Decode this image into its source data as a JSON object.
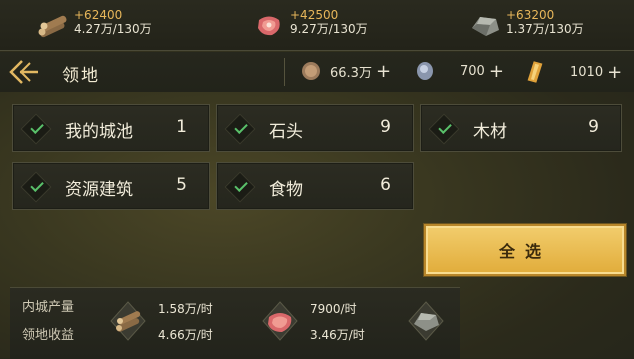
{
  "resources": [
    {
      "icon": "wood-icon",
      "gain": "+62400",
      "amount": "4.27万/130万"
    },
    {
      "icon": "meat-icon",
      "gain": "+42500",
      "amount": "9.27万/130万"
    },
    {
      "icon": "stone-icon",
      "gain": "+63200",
      "amount": "1.37万/130万"
    }
  ],
  "header": {
    "title": "领地"
  },
  "currencies": [
    {
      "icon": "coin-icon",
      "value": "66.3万",
      "plus": "+"
    },
    {
      "icon": "silver-icon",
      "value": "700",
      "plus": "+"
    },
    {
      "icon": "gold-icon",
      "value": "1010",
      "plus": "+"
    }
  ],
  "filters": [
    {
      "label": "我的城池",
      "count": "1"
    },
    {
      "label": "石头",
      "count": "9"
    },
    {
      "label": "木材",
      "count": "9"
    },
    {
      "label": "资源建筑",
      "count": "5"
    },
    {
      "label": "食物",
      "count": "6"
    }
  ],
  "select_all": "全选",
  "summary": {
    "labels": [
      "内城产量",
      "领地收益"
    ],
    "wood": {
      "rate": "1.58万/时",
      "income": "4.66万/时"
    },
    "meat": {
      "rate": "7900/时",
      "income": "3.46万/时"
    }
  },
  "colors": {
    "accent": "#e7b65a",
    "check": "#59c06a",
    "button": "#eebf55"
  }
}
